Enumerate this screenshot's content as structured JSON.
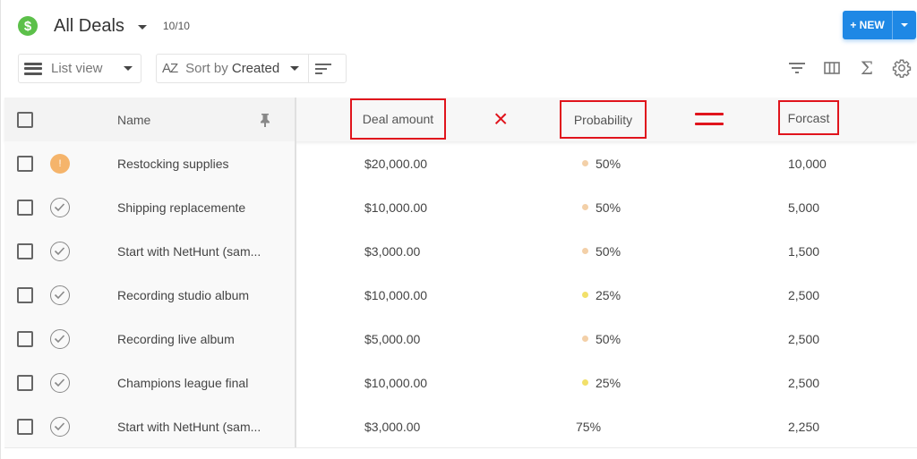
{
  "header": {
    "logo_glyph": "$",
    "title": "All Deals",
    "count": "10/10",
    "new_button_label": "+ NEW"
  },
  "toolbar": {
    "view_label": "List view",
    "sort_icon_text": "AZ",
    "sort_prefix": "Sort by ",
    "sort_value": "Created",
    "right_tools": [
      "filter-icon",
      "columns-icon",
      "sum-icon",
      "settings-icon"
    ],
    "sigma_glyph": "Σ",
    "gear_glyph": "⚙"
  },
  "table": {
    "headers": {
      "name": "Name",
      "pin_glyph": "📌",
      "amount": "Deal amount",
      "probability": "Probability",
      "forecast": "Forcast"
    },
    "annotations": {
      "multiply": "×",
      "equals": "=",
      "color": "#e0141c"
    },
    "rows": [
      {
        "status": "warning",
        "status_glyph": "!",
        "name": "Restocking supplies",
        "amount": "$20,000.00",
        "probability": "50%",
        "prob_dot": "#f3d0a8",
        "forecast": "10,000"
      },
      {
        "status": "done",
        "name": "Shipping replacemente",
        "amount": "$10,000.00",
        "probability": "50%",
        "prob_dot": "#f3d0a8",
        "forecast": "5,000"
      },
      {
        "status": "done",
        "name": "Start with NetHunt (sam...",
        "amount": "$3,000.00",
        "probability": "50%",
        "prob_dot": "#f3d0a8",
        "forecast": "1,500"
      },
      {
        "status": "done",
        "name": "Recording studio album",
        "amount": "$10,000.00",
        "probability": "25%",
        "prob_dot": "#f2e06a",
        "forecast": "2,500"
      },
      {
        "status": "done",
        "name": "Recording live album",
        "amount": "$5,000.00",
        "probability": "50%",
        "prob_dot": "#f3d0a8",
        "forecast": "2,500"
      },
      {
        "status": "done",
        "name": "Champions league final",
        "amount": "$10,000.00",
        "probability": "25%",
        "prob_dot": "#f2e06a",
        "forecast": "2,500"
      },
      {
        "status": "done",
        "name": "Start with NetHunt (sam...",
        "amount": "$3,000.00",
        "probability": "75%",
        "prob_dot": null,
        "forecast": "2,250"
      }
    ]
  },
  "colors": {
    "brand_green": "#5cc04a",
    "primary_blue": "#1e88e5",
    "warning_orange": "#f5b46b"
  }
}
